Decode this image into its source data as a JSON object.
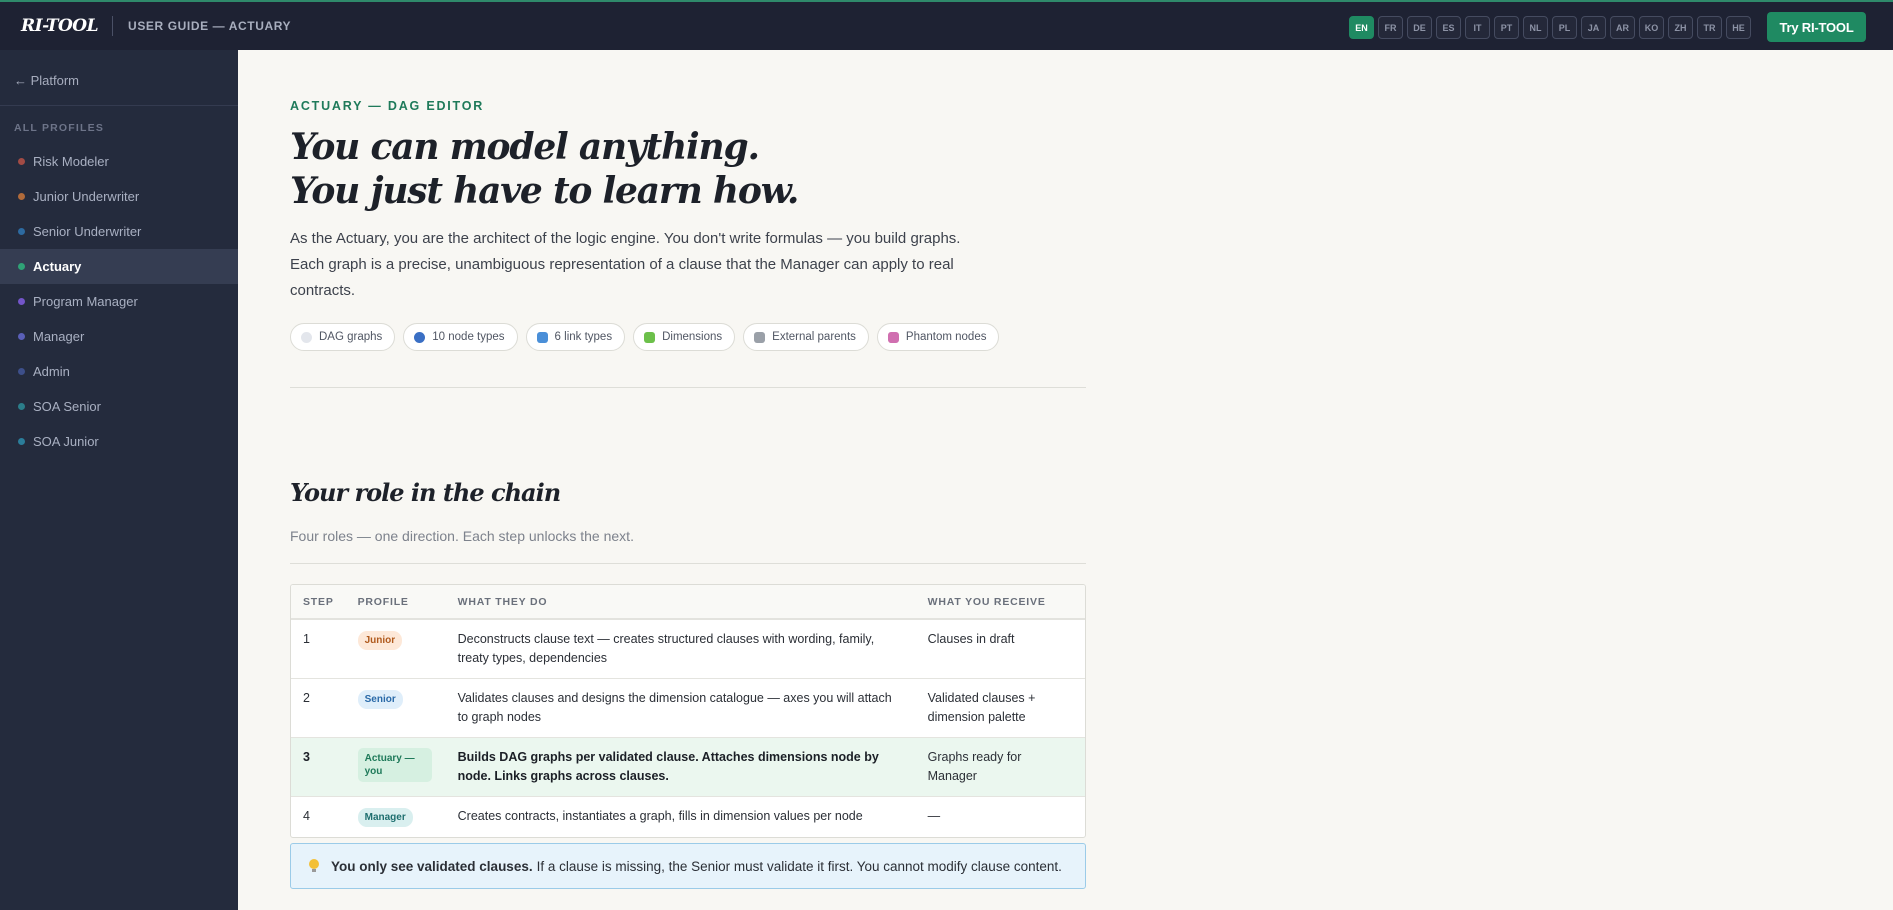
{
  "topbar": {
    "brand": "RI-TOOL",
    "guide_title": "USER GUIDE — ACTUARY",
    "languages": [
      "EN",
      "FR",
      "DE",
      "ES",
      "IT",
      "PT",
      "NL",
      "PL",
      "JA",
      "AR",
      "KO",
      "ZH",
      "TR",
      "HE"
    ],
    "active_language": "EN",
    "cta_label": "Try RI-TOOL"
  },
  "sidebar": {
    "back_label": "← Platform",
    "section_label": "ALL PROFILES",
    "items": [
      {
        "label": "Risk Modeler",
        "dot_color": "#a24b45",
        "active": false
      },
      {
        "label": "Junior Underwriter",
        "dot_color": "#b06a3a",
        "active": false
      },
      {
        "label": "Senior Underwriter",
        "dot_color": "#2d6aa0",
        "active": false
      },
      {
        "label": "Actuary",
        "dot_color": "#2fa276",
        "active": true
      },
      {
        "label": "Program Manager",
        "dot_color": "#7355c9",
        "active": false
      },
      {
        "label": "Manager",
        "dot_color": "#5a5fb8",
        "active": false
      },
      {
        "label": "Admin",
        "dot_color": "#3d4f8a",
        "active": false
      },
      {
        "label": "SOA Senior",
        "dot_color": "#2b7d8a",
        "active": false
      },
      {
        "label": "SOA Junior",
        "dot_color": "#2b7d9a",
        "active": false
      }
    ]
  },
  "hero": {
    "eyebrow": "ACTUARY — DAG EDITOR",
    "headline_line1": "You can model anything.",
    "headline_line2": "You just have to learn how.",
    "intro": "As the Actuary, you are the architect of the logic engine. You don't write formulas — you build graphs. Each graph is a precise, unambiguous representation of a clause that the Manager can apply to real contracts.",
    "chips": [
      {
        "label": "DAG graphs",
        "icon": "graph-icon",
        "color": "#e3e6ec"
      },
      {
        "label": "10 node types",
        "icon": "node-icon",
        "color": "#3a6fc4"
      },
      {
        "label": "6 link types",
        "icon": "link-arrow-icon",
        "color": "#4a8fd8"
      },
      {
        "label": "Dimensions",
        "icon": "puzzle-icon",
        "color": "#6cc04a"
      },
      {
        "label": "External parents",
        "icon": "chain-icon",
        "color": "#9aa0a8"
      },
      {
        "label": "Phantom nodes",
        "icon": "ghost-icon",
        "color": "#d06fb0"
      }
    ]
  },
  "chain": {
    "title": "Your role in the chain",
    "subtitle": "Four roles — one direction. Each step unlocks the next.",
    "columns": [
      "STEP",
      "PROFILE",
      "WHAT THEY DO",
      "WHAT YOU RECEIVE"
    ],
    "rows": [
      {
        "step": "1",
        "profile": "Junior",
        "badge": "junior",
        "what": "Deconstructs clause text — creates structured clauses with wording, family, treaty types, dependencies",
        "receive": "Clauses in draft",
        "highlight": false
      },
      {
        "step": "2",
        "profile": "Senior",
        "badge": "senior",
        "what": "Validates clauses and designs the dimension catalogue — axes you will attach to graph nodes",
        "receive": "Validated clauses + dimension palette",
        "highlight": false
      },
      {
        "step": "3",
        "profile": "Actuary — you",
        "badge": "actuary",
        "what": "Builds DAG graphs per validated clause. Attaches dimensions node by node. Links graphs across clauses.",
        "receive": "Graphs ready for Manager",
        "highlight": true
      },
      {
        "step": "4",
        "profile": "Manager",
        "badge": "manager",
        "what": "Creates contracts, instantiates a graph, fills in dimension values per node",
        "receive": "—",
        "highlight": false
      }
    ]
  },
  "callout": {
    "bold": "You only see validated clauses.",
    "text": "If a clause is missing, the Senior must validate it first. You cannot modify clause content."
  }
}
